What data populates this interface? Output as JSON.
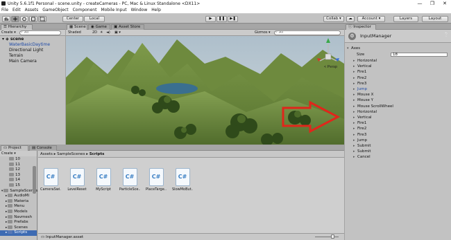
{
  "window": {
    "title": "Unity 5.6.1f1 Personal - scene.unity - createCameras - PC, Mac & Linux Standalone <DX11>",
    "controls": [
      "—",
      "❐",
      "✕"
    ]
  },
  "menu": [
    "File",
    "Edit",
    "Assets",
    "GameObject",
    "Component",
    "Mobile Input",
    "Window",
    "Help"
  ],
  "toolbar": {
    "pivot_label": "Center",
    "space_label": "Local",
    "collab_label": "Collab ▾",
    "account_label": "Account ▾",
    "layers_label": "Layers",
    "layout_label": "Layout"
  },
  "hierarchy": {
    "tab_label": "Hierarchy",
    "create_label": "Create ▾",
    "search_placeholder": "All",
    "scene_name": "scene",
    "items": [
      {
        "label": "WaterBasicDaytime",
        "selected": true
      },
      {
        "label": "Directional Light",
        "selected": false
      },
      {
        "label": "Terrain",
        "selected": false
      },
      {
        "label": "Main Camera",
        "selected": false
      }
    ]
  },
  "scene": {
    "tabs": [
      "Scene",
      "Game",
      "Asset Store"
    ],
    "shading": "Shaded",
    "mode_2d": "2D",
    "gizmos_label": "Gizmos ▾",
    "search_placeholder": "All",
    "persp_label": "< Persp"
  },
  "project": {
    "tabs": [
      "Project",
      "Console"
    ],
    "create_label": "Create ▾",
    "tree": [
      {
        "label": "10",
        "indent": 2
      },
      {
        "label": "11",
        "indent": 2
      },
      {
        "label": "12",
        "indent": 2
      },
      {
        "label": "13",
        "indent": 2
      },
      {
        "label": "14",
        "indent": 2
      },
      {
        "label": "15",
        "indent": 2
      },
      {
        "label": "SampleScenes",
        "indent": 0
      },
      {
        "label": "AudioMi",
        "indent": 1
      },
      {
        "label": "Materia",
        "indent": 1
      },
      {
        "label": "Menu",
        "indent": 1
      },
      {
        "label": "Models",
        "indent": 1
      },
      {
        "label": "Navmesh",
        "indent": 1
      },
      {
        "label": "Prefabs",
        "indent": 1
      },
      {
        "label": "Scenes",
        "indent": 1
      },
      {
        "label": "Scripts",
        "indent": 1,
        "selected": true
      }
    ],
    "breadcrumb": [
      "Assets",
      "SampleScenes",
      "Scripts"
    ],
    "assets": [
      {
        "label": "CameraSwi...",
        "icon": "C#"
      },
      {
        "label": "LevelReset",
        "icon": "C#"
      },
      {
        "label": "MyScript",
        "icon": "C#"
      },
      {
        "label": "ParticleSce...",
        "icon": "C#"
      },
      {
        "label": "PlaceTarge...",
        "icon": "C#"
      },
      {
        "label": "SlowMoBut...",
        "icon": "C#"
      }
    ],
    "footer_file": "InputManager.asset"
  },
  "inspector": {
    "tab_label": "Inspector",
    "component_title": "InputManager",
    "axes_label": "Axes",
    "size_label": "Size",
    "size_value": "18",
    "items": [
      {
        "label": "Horizontal",
        "highlight": false
      },
      {
        "label": "Vertical",
        "highlight": false
      },
      {
        "label": "Fire1",
        "highlight": false
      },
      {
        "label": "Fire2",
        "highlight": false
      },
      {
        "label": "Fire3",
        "highlight": false
      },
      {
        "label": "Jump",
        "highlight": true
      },
      {
        "label": "Mouse X",
        "highlight": false
      },
      {
        "label": "Mouse Y",
        "highlight": false
      },
      {
        "label": "Mouse ScrollWheel",
        "highlight": false
      },
      {
        "label": "Horizontal",
        "highlight": false
      },
      {
        "label": "Vertical",
        "highlight": false
      },
      {
        "label": "Fire1",
        "highlight": false
      },
      {
        "label": "Fire2",
        "highlight": false
      },
      {
        "label": "Fire3",
        "highlight": false
      },
      {
        "label": "Jump",
        "highlight": false
      },
      {
        "label": "Submit",
        "highlight": false
      },
      {
        "label": "Submit",
        "highlight": false
      },
      {
        "label": "Cancel",
        "highlight": false
      }
    ]
  },
  "colors": {
    "accent": "#1c48a6",
    "arrow": "#e0261b",
    "panel": "#c2c2c2",
    "sky": "#b5c4cf"
  }
}
